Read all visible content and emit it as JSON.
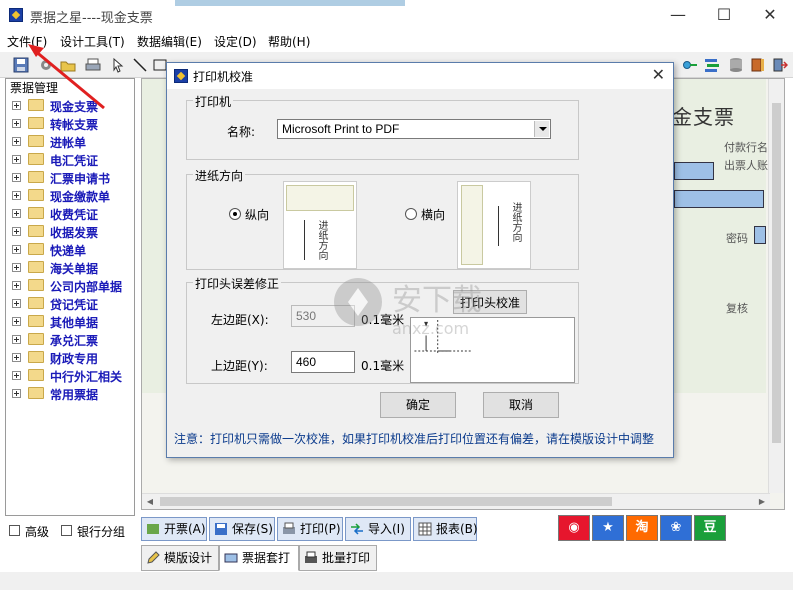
{
  "window": {
    "title": "票据之星----现金支票",
    "controls": {
      "minimize": "—",
      "maximize": "☐",
      "close": "✕"
    }
  },
  "menu": [
    "文件(F)",
    "设计工具(T)",
    "数据编辑(E)",
    "设定(D)",
    "帮助(H)"
  ],
  "left_panel": {
    "header": "票据管理",
    "items": [
      "现金支票",
      "转帐支票",
      "进帐单",
      "电汇凭证",
      "汇票申请书",
      "现金缴款单",
      "收费凭证",
      "收据发票",
      "快递单",
      "海关单据",
      "公司内部单据",
      "贷记凭证",
      "其他单据",
      "承兑汇票",
      "财政专用",
      "中行外汇相关",
      "常用票据"
    ],
    "options": {
      "advanced": "高级",
      "bank_group": "银行分组"
    }
  },
  "ticket": {
    "title": "金支票",
    "labels": {
      "payer": "付款行名",
      "issuer": "出票人账",
      "password": "密码",
      "review": "复核"
    }
  },
  "action_buttons": [
    "开票(A)",
    "保存(S)",
    "打印(P)",
    "导入(I)",
    "报表(B)"
  ],
  "social_buttons": [
    {
      "name": "weibo-icon",
      "color": "#e6162d"
    },
    {
      "name": "star-icon",
      "color": "#2f6fd6"
    },
    {
      "name": "taobao-icon",
      "color": "#ff6a00"
    },
    {
      "name": "baidu-icon",
      "color": "#2f6fd6"
    },
    {
      "name": "douban-icon",
      "color": "#1a9f3a",
      "text": "豆"
    }
  ],
  "tabs": [
    "模版设计",
    "票据套打",
    "批量打印"
  ],
  "dialog": {
    "title": "打印机校准",
    "printer": {
      "group": "打印机",
      "name_label": "名称:",
      "name_value": "Microsoft Print to PDF"
    },
    "direction": {
      "group": "进纸方向",
      "portrait": "纵向",
      "landscape": "横向",
      "selected": "纵向",
      "paper_text": "进纸方向"
    },
    "correction": {
      "group": "打印头误差修正",
      "left_label": "左边距(X):",
      "left_value": "530",
      "left_unit": "0.1毫米",
      "top_label": "上边距(Y):",
      "top_value": "460",
      "top_unit": "0.1毫米",
      "calibrate_button": "打印头校准"
    },
    "ok": "确定",
    "cancel": "取消",
    "note": "注意：打印机只需做一次校准，如果打印机校准后打印位置还有偏差，请在模版设计中调整"
  },
  "watermark": {
    "text": "安下载",
    "sub": "anxz.com"
  }
}
